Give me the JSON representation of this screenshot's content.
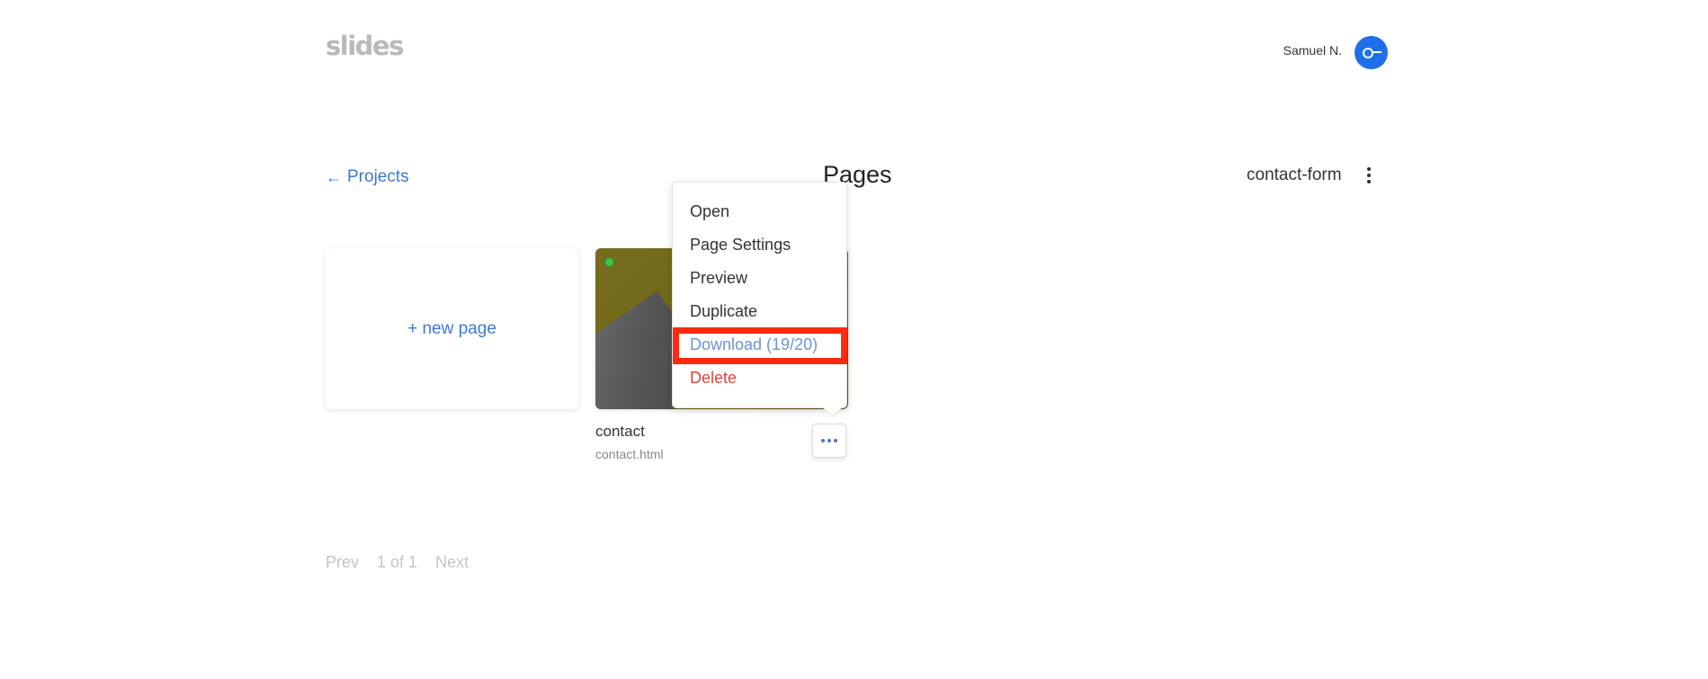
{
  "header": {
    "logo": "slides",
    "user_name": "Samuel N."
  },
  "nav": {
    "back_arrow": "←",
    "back_label": "Projects"
  },
  "page_title": "Pages",
  "project": {
    "name": "contact-form"
  },
  "new_page_label": "+ new page",
  "pages": [
    {
      "name": "contact",
      "file": "contact.html",
      "status_color": "#43c14b"
    }
  ],
  "context_menu": {
    "items": [
      {
        "label": "Open"
      },
      {
        "label": "Page Settings"
      },
      {
        "label": "Preview"
      },
      {
        "label": "Duplicate"
      },
      {
        "label": "Download (19/20)"
      },
      {
        "label": "Delete"
      }
    ]
  },
  "pagination": {
    "prev": "Prev",
    "status": "1 of 1",
    "next": "Next"
  },
  "colors": {
    "accent": "#3c78d8",
    "avatar": "#1f6fea",
    "danger": "#e0413a",
    "highlight": "#ff2a0f"
  },
  "icons": {
    "avatar": "avatar-face-icon",
    "back": "arrow-left-icon",
    "project_menu": "more-vertical-icon",
    "page_menu": "more-horizontal-icon",
    "status": "status-dot-icon"
  }
}
